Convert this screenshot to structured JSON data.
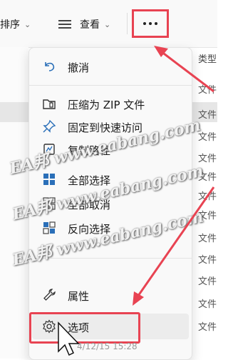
{
  "toolbar": {
    "sort_label": "排序",
    "view_label": "查看",
    "more_label": "..."
  },
  "file_list": {
    "column_header": "类型",
    "rows": [
      "文件",
      "文件",
      "文件",
      "文件",
      "文件",
      "文件",
      "文件",
      "文件",
      "文件",
      "文件",
      "文件",
      "文件"
    ]
  },
  "menu": {
    "items": [
      {
        "label": "撤消",
        "icon": "undo-icon"
      },
      {
        "label": "压缩为 ZIP 文件",
        "icon": "zip-icon"
      },
      {
        "label": "固定到快速访问",
        "icon": "pin-icon"
      },
      {
        "label": "复制路径",
        "icon": "copy-path-icon"
      },
      {
        "label": "全部选择",
        "icon": "select-all-icon"
      },
      {
        "label": "全部取消",
        "icon": "select-none-icon"
      },
      {
        "label": "反向选择",
        "icon": "invert-selection-icon"
      },
      {
        "label": "属性",
        "icon": "properties-icon"
      },
      {
        "label": "选项",
        "icon": "gear-icon"
      }
    ],
    "bottom_partial_text": "4/12/15 15:28"
  },
  "watermarks": [
    "EA邦 www.eabang.com",
    "EA邦 www.eabang.com",
    "EA邦 www.eabang.com"
  ],
  "colors": {
    "annotation_red": "#e84352",
    "accent_blue": "#1a73c9"
  }
}
